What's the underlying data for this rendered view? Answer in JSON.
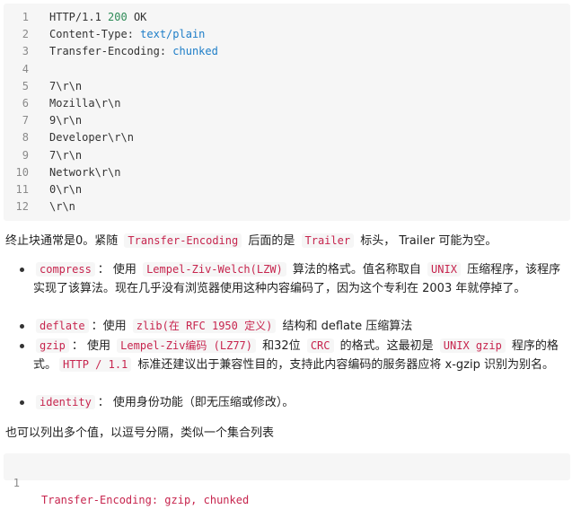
{
  "code1": {
    "lines": [
      {
        "n": "1",
        "parts": [
          {
            "t": "HTTP/1.1 ",
            "c": ""
          },
          {
            "t": "200",
            "c": "num"
          },
          {
            "t": " OK",
            "c": ""
          }
        ]
      },
      {
        "n": "2",
        "parts": [
          {
            "t": "Content-Type: ",
            "c": ""
          },
          {
            "t": "text/plain",
            "c": "val"
          }
        ]
      },
      {
        "n": "3",
        "parts": [
          {
            "t": "Transfer-Encoding: ",
            "c": ""
          },
          {
            "t": "chunked",
            "c": "val"
          }
        ]
      },
      {
        "n": "4",
        "parts": []
      },
      {
        "n": "5",
        "parts": [
          {
            "t": "7\\r\\n",
            "c": ""
          }
        ]
      },
      {
        "n": "6",
        "parts": [
          {
            "t": "Mozilla\\r\\n",
            "c": ""
          }
        ]
      },
      {
        "n": "7",
        "parts": [
          {
            "t": "9\\r\\n",
            "c": ""
          }
        ]
      },
      {
        "n": "8",
        "parts": [
          {
            "t": "Developer\\r\\n",
            "c": ""
          }
        ]
      },
      {
        "n": "9",
        "parts": [
          {
            "t": "7\\r\\n",
            "c": ""
          }
        ]
      },
      {
        "n": "10",
        "parts": [
          {
            "t": "Network\\r\\n",
            "c": ""
          }
        ]
      },
      {
        "n": "11",
        "parts": [
          {
            "t": "0\\r\\n",
            "c": ""
          }
        ]
      },
      {
        "n": "12",
        "parts": [
          {
            "t": "\\r\\n",
            "c": ""
          }
        ]
      }
    ]
  },
  "para1": [
    {
      "t": "终止块通常是0。紧随 ",
      "code": false
    },
    {
      "t": "Transfer-Encoding",
      "code": true
    },
    {
      "t": " 后面的是 ",
      "code": false
    },
    {
      "t": "Trailer",
      "code": true
    },
    {
      "t": " 标头， Trailer 可能为空。",
      "code": false
    }
  ],
  "list": [
    {
      "id": "compress",
      "parts": [
        {
          "t": "compress",
          "code": true
        },
        {
          "t": "： 使用 ",
          "code": false
        },
        {
          "t": "Lempel-Ziv-Welch(LZW)",
          "code": true
        },
        {
          "t": " 算法的格式。值名称取自 ",
          "code": false
        },
        {
          "t": "UNIX",
          "code": true
        },
        {
          "t": " 压缩程序，该程序实现了该算法。现在几乎没有浏览器使用这种内容编码了，因为这个专利在 2003 年就停掉了。",
          "code": false
        }
      ]
    },
    {
      "id": "deflate",
      "parts": [
        {
          "t": "deflate",
          "code": true
        },
        {
          "t": "：使用 ",
          "code": false
        },
        {
          "t": "zlib(在 RFC 1950 定义)",
          "code": true
        },
        {
          "t": " 结构和 deflate 压缩算法",
          "code": false
        }
      ]
    },
    {
      "id": "gzip",
      "parts": [
        {
          "t": "gzip",
          "code": true
        },
        {
          "t": "： 使用 ",
          "code": false
        },
        {
          "t": "Lempel-Ziv编码 (LZ77)",
          "code": true
        },
        {
          "t": " 和32位 ",
          "code": false
        },
        {
          "t": "CRC",
          "code": true
        },
        {
          "t": " 的格式。这最初是 ",
          "code": false
        },
        {
          "t": "UNIX gzip",
          "code": true
        },
        {
          "t": " 程序的格式。",
          "code": false
        },
        {
          "t": "HTTP / 1.1",
          "code": true
        },
        {
          "t": " 标准还建议出于兼容性目的，支持此内容编码的服务器应将 x-gzip 识别为别名。",
          "code": false
        }
      ]
    },
    {
      "id": "identity",
      "parts": [
        {
          "t": "identity",
          "code": true
        },
        {
          "t": "： 使用身份功能（即无压缩或修改）。",
          "code": false
        }
      ]
    }
  ],
  "para2": "也可以列出多个值，以逗号分隔，类似一个集合列表",
  "code2": {
    "n": "1",
    "text": "Transfer-Encoding: gzip, chunked"
  }
}
